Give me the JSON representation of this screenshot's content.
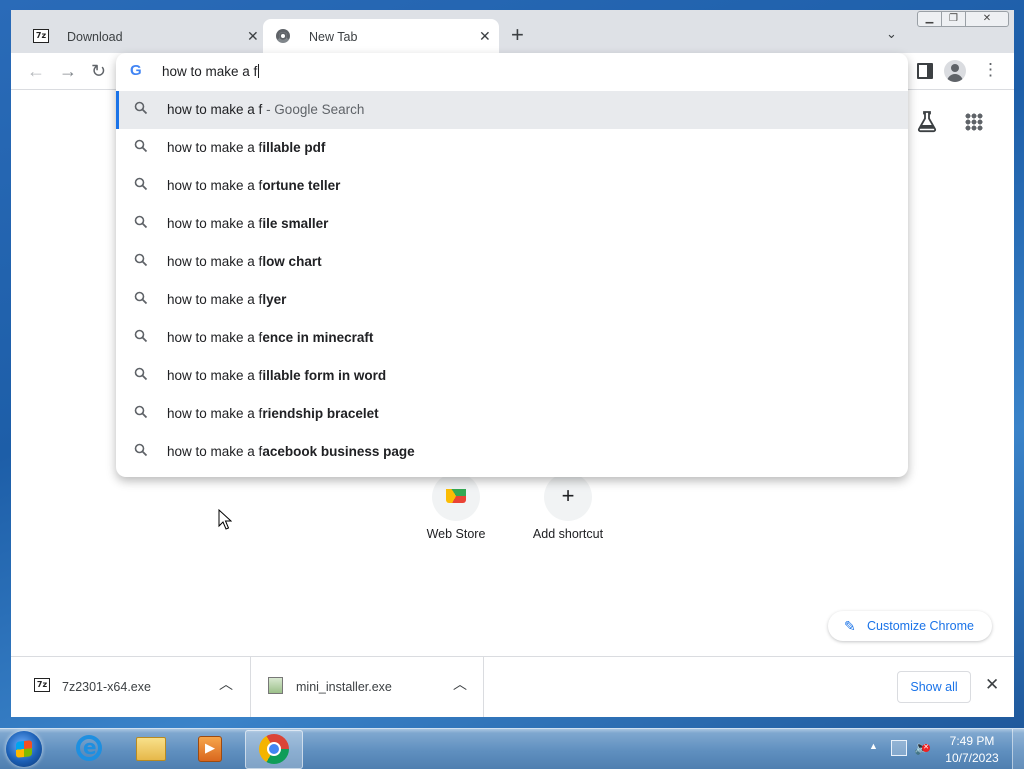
{
  "tabs": [
    {
      "title": "Download",
      "active": false,
      "icon": "7zip-icon"
    },
    {
      "title": "New Tab",
      "active": true,
      "icon": "chrome-icon"
    }
  ],
  "omnibox": {
    "text": "how to make a f",
    "suggestions": [
      {
        "prefix": "how to make a f",
        "suffix": " - Google Search",
        "selected": true
      },
      {
        "prefix": "how to make a f",
        "bold": "illable pdf"
      },
      {
        "prefix": "how to make a f",
        "bold": "ortune teller"
      },
      {
        "prefix": "how to make a f",
        "bold": "ile smaller"
      },
      {
        "prefix": "how to make a f",
        "bold": "low chart"
      },
      {
        "prefix": "how to make a f",
        "bold": "lyer"
      },
      {
        "prefix": "how to make a f",
        "bold": "ence in minecraft"
      },
      {
        "prefix": "how to make a f",
        "bold": "illable form in word"
      },
      {
        "prefix": "how to make a f",
        "bold": "riendship bracelet"
      },
      {
        "prefix": "how to make a f",
        "bold": "acebook business page"
      }
    ]
  },
  "ntp": {
    "shortcuts": [
      {
        "label": "Web Store"
      },
      {
        "label": "Add shortcut"
      }
    ],
    "customize_label": "Customize Chrome"
  },
  "downloads": {
    "items": [
      {
        "name": "7z2301-x64.exe"
      },
      {
        "name": "mini_installer.exe"
      }
    ],
    "show_all_label": "Show all"
  },
  "taskbar": {
    "time": "7:49 PM",
    "date": "10/7/2023",
    "pinned": [
      "internet-explorer-icon",
      "windows-explorer-icon",
      "media-player-icon",
      "chrome-icon"
    ]
  },
  "colors": {
    "accent_blue": "#1a73e8",
    "tabstrip_bg": "#dee1e6",
    "selected_suggestion_bg": "#e8eaed"
  }
}
